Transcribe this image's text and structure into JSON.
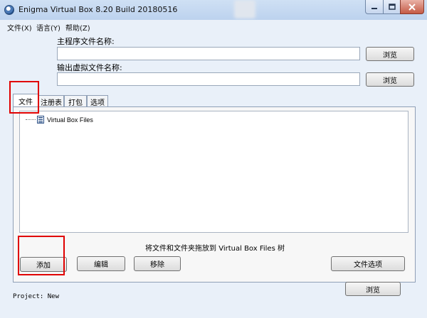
{
  "window": {
    "title": "Enigma Virtual Box 8.20 Build 20180516"
  },
  "menu": [
    {
      "label": "文件(X)"
    },
    {
      "label": "语言(Y)"
    },
    {
      "label": "帮助(Z)"
    }
  ],
  "main_exe": {
    "label": "主程序文件名称:",
    "value": "",
    "browse_label": "浏览"
  },
  "output_file": {
    "label": "输出虚拟文件名称:",
    "value": "",
    "browse_label": "浏览"
  },
  "tabs": [
    {
      "label": "文件",
      "active": true
    },
    {
      "label": "注册表"
    },
    {
      "label": "打包"
    },
    {
      "label": "选项"
    }
  ],
  "tree": {
    "root_label": "Virtual Box Files",
    "root_icon": "file-list-icon"
  },
  "drop_hint": "将文件和文件夹拖放到 Virtual Box Files 树",
  "file_buttons": {
    "add": "添加",
    "edit": "编辑",
    "remove": "移除",
    "file_options": "文件选项"
  },
  "project": "Project: New",
  "process_button": "浏览",
  "colors": {
    "highlight": "#e00000",
    "titlebar": "#bcd2ee",
    "close": "#c45a45"
  },
  "icons": {
    "app": "enigma-app-icon",
    "minimize": "minimize-icon",
    "maximize": "maximize-icon",
    "close": "close-icon"
  }
}
